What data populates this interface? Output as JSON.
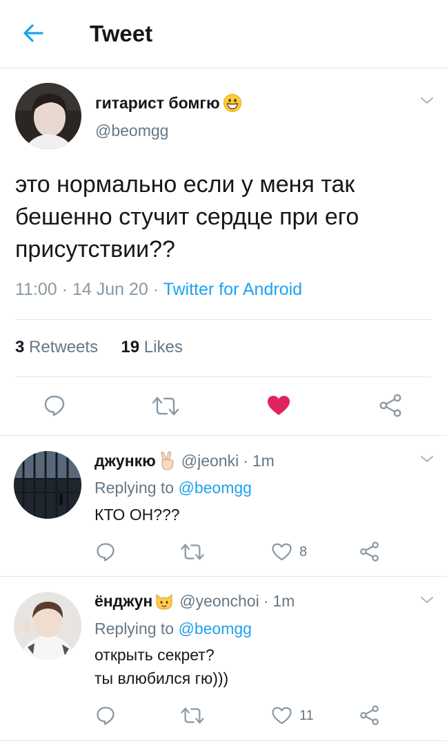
{
  "header": {
    "title": "Tweet"
  },
  "main_tweet": {
    "author_name": "гитарист бомгю",
    "handle": "@beomgg",
    "text": "это нормально если у меня так бешенно стучит сердце при его присутствии??",
    "time": "11:00",
    "date": "14 Jun 20",
    "source": "Twitter for Android",
    "retweets_count": "3",
    "retweets_label": "Retweets",
    "likes_count": "19",
    "likes_label": "Likes",
    "liked": true
  },
  "replies": [
    {
      "author_name": "джункю",
      "handle": "@jeonki",
      "time": "1m",
      "replying_label": "Replying to",
      "replying_to": "@beomgg",
      "text_lines": [
        "КТО ОН???"
      ],
      "like_count": "8"
    },
    {
      "author_name": "ёнджун",
      "handle": "@yeonchoi",
      "time": "1m",
      "replying_label": "Replying to",
      "replying_to": "@beomgg",
      "text_lines": [
        "открыть секрет?",
        "ты влюбился гю)))"
      ],
      "like_count": "11"
    }
  ],
  "colors": {
    "accent": "#1da1f2",
    "like": "#e0245e",
    "muted": "#657786",
    "icon": "#8899a6"
  }
}
